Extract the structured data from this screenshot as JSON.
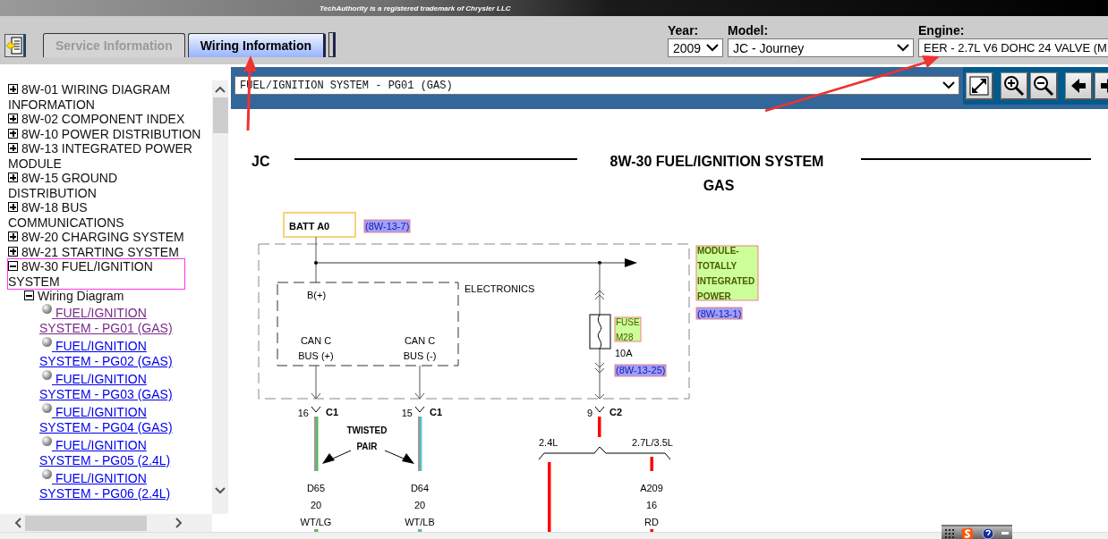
{
  "header": {
    "trademark": "TechAuthority is a registered trademark of Chrysler LLC"
  },
  "tabs": [
    {
      "label": "Service Information",
      "selected": false
    },
    {
      "label": "Wiring Information",
      "selected": true
    }
  ],
  "filters": [
    {
      "label": "Year:",
      "value": "2009",
      "kind": "dropdown"
    },
    {
      "label": "Model:",
      "value": "JC - Journey",
      "kind": "dropdown"
    },
    {
      "label": "Engine:",
      "value": "EER - 2.7L V6 DOHC 24 VALVE (M",
      "kind": "cut"
    }
  ],
  "tree": [
    {
      "label": "8W-01 WIRING DIAGRAM INFORMATION",
      "expanded": false,
      "selected": false
    },
    {
      "label": "8W-02 COMPONENT INDEX",
      "expanded": false,
      "selected": false
    },
    {
      "label": "8W-10 POWER DISTRIBUTION",
      "expanded": false,
      "selected": false
    },
    {
      "label": "8W-13 INTEGRATED POWER MODULE",
      "expanded": false,
      "selected": false
    },
    {
      "label": "8W-15 GROUND DISTRIBUTION",
      "expanded": false,
      "selected": false
    },
    {
      "label": "8W-18 BUS COMMUNICATIONS",
      "expanded": false,
      "selected": false
    },
    {
      "label": "8W-20 CHARGING SYSTEM",
      "expanded": false,
      "selected": false
    },
    {
      "label": "8W-21 STARTING SYSTEM",
      "expanded": false,
      "selected": false
    },
    {
      "label": "8W-30 FUEL/IGNITION SYSTEM",
      "expanded": true,
      "selected": true,
      "children": [
        {
          "label": "Wiring Diagram",
          "expanded": true,
          "children": [
            {
              "label": "FUEL/IGNITION SYSTEM - PG01 (GAS)",
              "visited": true
            },
            {
              "label": "FUEL/IGNITION SYSTEM - PG02 (GAS)",
              "visited": false
            },
            {
              "label": "FUEL/IGNITION SYSTEM - PG03 (GAS)",
              "visited": false
            },
            {
              "label": "FUEL/IGNITION SYSTEM - PG04 (GAS)",
              "visited": false
            },
            {
              "label": "FUEL/IGNITION SYSTEM - PG05 (2.4L)",
              "visited": false
            },
            {
              "label": "FUEL/IGNITION SYSTEM - PG06 (2.4L)",
              "visited": false
            }
          ]
        }
      ]
    }
  ],
  "diagram_select": {
    "value": "FUEL/IGNITION SYSTEM - PG01 (GAS)"
  },
  "diagram": {
    "vehicle": "JC",
    "title": "8W-30 FUEL/IGNITION SYSTEM",
    "subtitle": "GAS",
    "source": {
      "name": "BATT A0",
      "ref": "(8W-13-7)"
    },
    "module": {
      "name_lines": [
        "MODULE-",
        "TOTALLY",
        "INTEGRATED",
        "POWER"
      ],
      "ref": "(8W-13-1)"
    },
    "electronics": {
      "name": "ELECTRONICS",
      "power_pin": "B(+)",
      "bus_pins": [
        [
          "CAN C",
          "BUS (+)"
        ],
        [
          "CAN C",
          "BUS (-)"
        ]
      ]
    },
    "fuse": {
      "name_lines": [
        "FUSE",
        "M28"
      ],
      "rating": "10A",
      "ref": "(8W-13-25)"
    },
    "connectors": [
      {
        "pin": "16",
        "name": "C1"
      },
      {
        "pin": "15",
        "name": "C1"
      },
      {
        "pin": "9",
        "name": "C2"
      }
    ],
    "twisted_pair": [
      "TWISTED",
      "PAIR"
    ],
    "splice": [
      "2.4L",
      "2.7L/3.5L"
    ],
    "wires": [
      {
        "circuit": "D65",
        "gauge": "20",
        "color_code": "WT/LG",
        "color": "#33cc33"
      },
      {
        "circuit": "D64",
        "gauge": "20",
        "color_code": "WT/LB",
        "color": "#33dddd"
      },
      {
        "circuit": "A209",
        "gauge": "16",
        "color_code": "RD",
        "color": "#ff0000"
      }
    ]
  }
}
